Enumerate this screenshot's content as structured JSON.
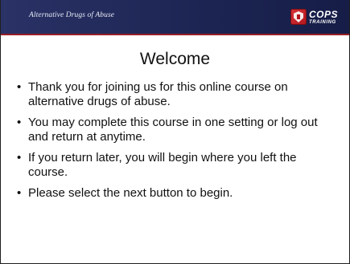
{
  "header": {
    "title": "Alternative Drugs of Abuse",
    "logo": {
      "main": "COPS",
      "sub": "TRAINING",
      "icon": "badge-icon"
    },
    "colors": {
      "bar": "#1c2452",
      "accent_line": "#9a1e24",
      "badge": "#c4222a"
    }
  },
  "slide": {
    "title": "Welcome",
    "bullets": [
      "Thank you for joining us for this online course on alternative drugs of abuse.",
      "You may complete this course in one setting or log out and return at anytime.",
      "If you return later, you will begin where you left the course.",
      "Please select the next button to begin."
    ]
  }
}
